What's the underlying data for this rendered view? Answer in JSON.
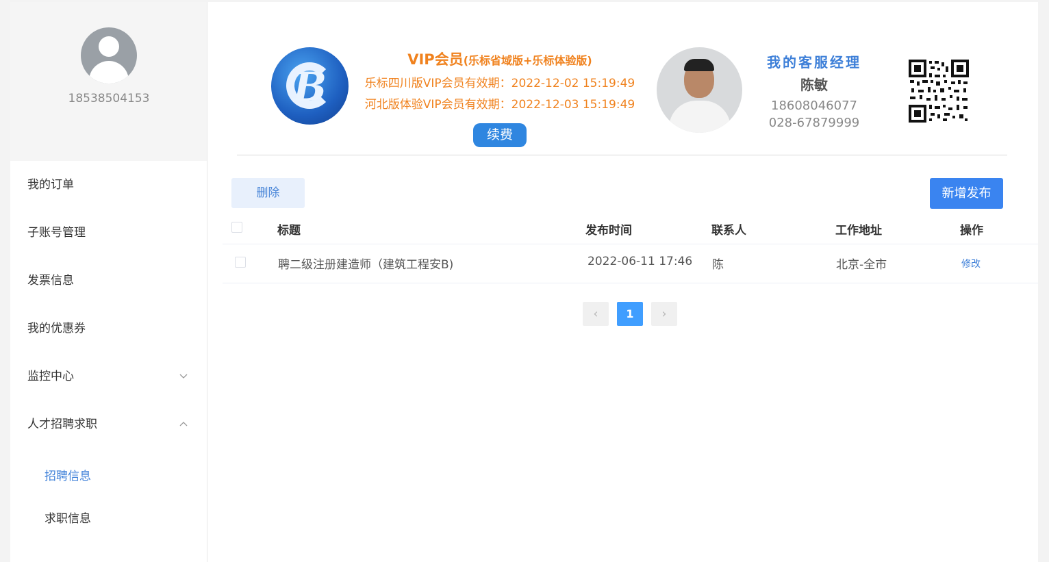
{
  "user": {
    "phone": "18538504153"
  },
  "sidebar": {
    "items": [
      {
        "label": "我的订单"
      },
      {
        "label": "子账号管理"
      },
      {
        "label": "发票信息"
      },
      {
        "label": "我的优惠券"
      },
      {
        "label": "监控中心",
        "chevron": "chevron-down-icon"
      },
      {
        "label": "人才招聘求职",
        "chevron": "chevron-up-icon"
      }
    ],
    "subitems": [
      {
        "label": "招聘信息",
        "active": true
      },
      {
        "label": "求职信息"
      }
    ]
  },
  "vip": {
    "title": "VIP会员",
    "subtitle": "(乐标省域版+乐标体验版)",
    "line1": "乐标四川版VIP会员有效期：2022-12-02 15:19:49",
    "line2": "河北版体验VIP会员有效期：2022-12-03 15:19:49",
    "renew_label": "续费",
    "logo_letter": "B"
  },
  "manager": {
    "title": "我的客服经理",
    "name": "陈敏",
    "phone1": "18608046077",
    "phone2": "028-67879999"
  },
  "toolbar": {
    "delete_label": "删除",
    "add_label": "新增发布"
  },
  "table": {
    "headers": {
      "title": "标题",
      "time": "发布时间",
      "contact": "联系人",
      "address": "工作地址",
      "action": "操作"
    },
    "rows": [
      {
        "title": "聘二级注册建造师（建筑工程安B)",
        "time": "2022-06-11 17:46",
        "contact": "陈",
        "address": "北京-全市",
        "action": "修改"
      }
    ]
  },
  "pagination": {
    "prev": "‹",
    "current": "1",
    "next": "›"
  },
  "colors": {
    "accent": "#409eff",
    "vip_orange": "#f0821e",
    "manager_blue": "#3d7fd8"
  }
}
